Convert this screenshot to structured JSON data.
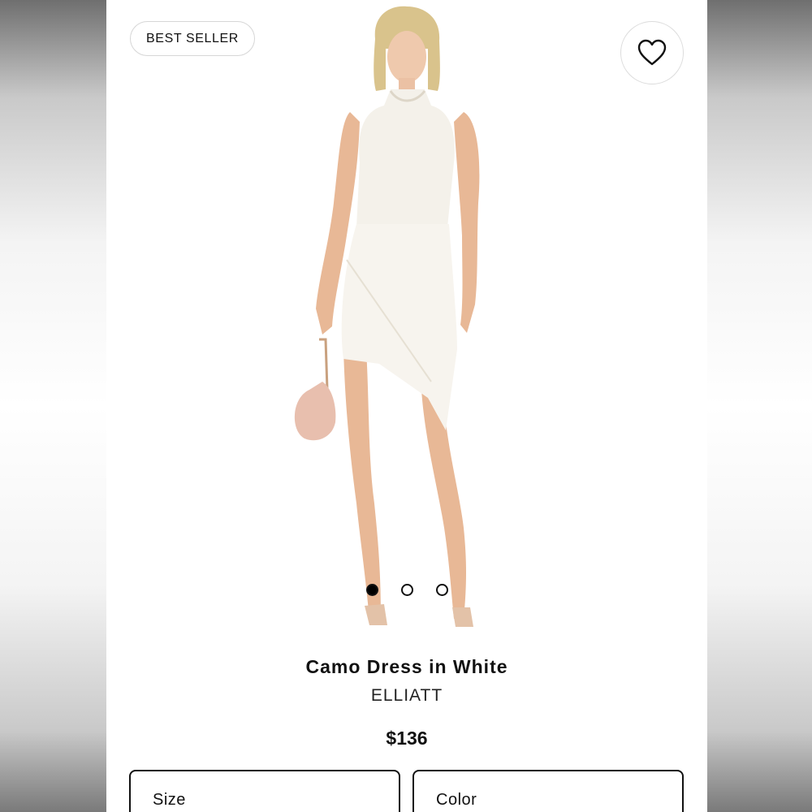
{
  "badge": "BEST SELLER",
  "favorite": {
    "icon": "heart-icon"
  },
  "product": {
    "title": "Camo Dress in White",
    "brand": "ELLIATT",
    "price": "$136"
  },
  "carousel": {
    "total": 3,
    "active": 1
  },
  "options": {
    "size_label": "Size",
    "color_label": "Color"
  }
}
